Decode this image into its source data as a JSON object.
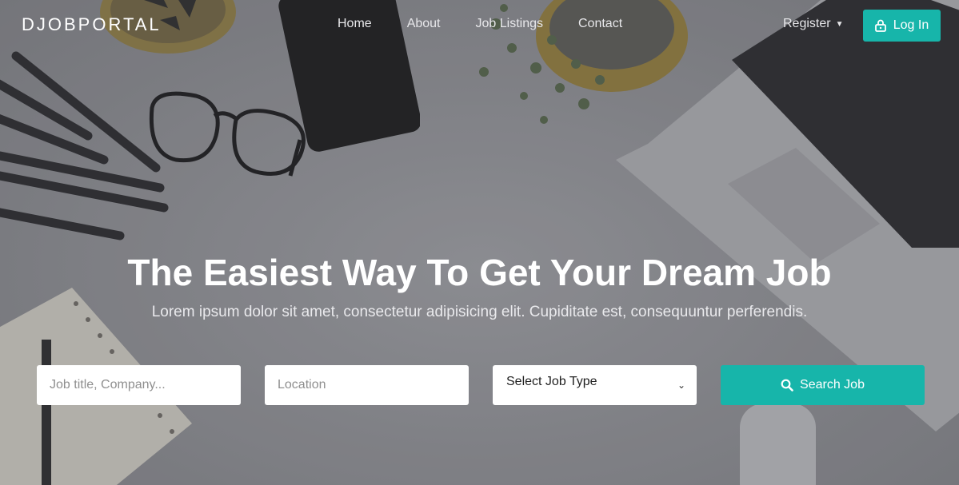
{
  "brand": {
    "name": "DJOBPORTAL"
  },
  "nav": {
    "links": [
      "Home",
      "About",
      "Job Listings",
      "Contact"
    ],
    "register": "Register",
    "login": "Log In"
  },
  "hero": {
    "title": "The Easiest Way To Get Your Dream Job",
    "subtitle": "Lorem ipsum dolor sit amet, consectetur adipisicing elit. Cupiditate est, consequuntur perferendis."
  },
  "search": {
    "keyword_placeholder": "Job title, Company...",
    "location_placeholder": "Location",
    "job_type_selected": "Select Job Type",
    "button_label": "Search Job"
  },
  "colors": {
    "accent": "#17b5aa",
    "text_light": "#ffffff"
  },
  "icons": {
    "login": "lock-icon",
    "register_menu": "caret-down-icon",
    "job_type": "chevron-down-icon",
    "search": "search-icon"
  }
}
